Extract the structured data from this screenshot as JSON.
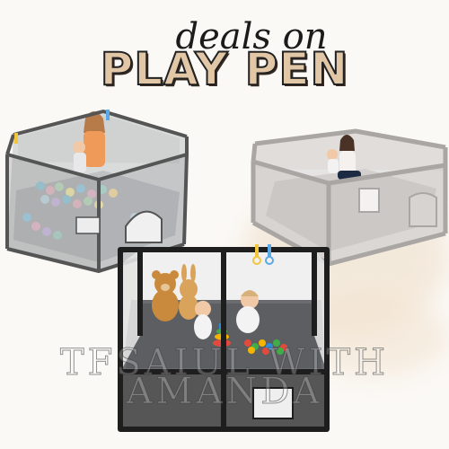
{
  "header": {
    "script_line": "deals on",
    "title": "PLAY PEN"
  },
  "watermark": {
    "line1": "TFSAIUL WITH",
    "line2": "AMANDA"
  },
  "colors": {
    "title_fill": "#e2c7a7",
    "title_outline": "#222222",
    "background": "#fbf9f6",
    "wash": "#ecd6bc"
  },
  "products": [
    {
      "name": "dark-grey-playpen-with-balls",
      "frame_color": "#555555"
    },
    {
      "name": "light-grey-large-playpen",
      "frame_color": "#a9a6a4"
    },
    {
      "name": "black-playpen-with-toys",
      "frame_color": "#1e1e1e"
    }
  ]
}
